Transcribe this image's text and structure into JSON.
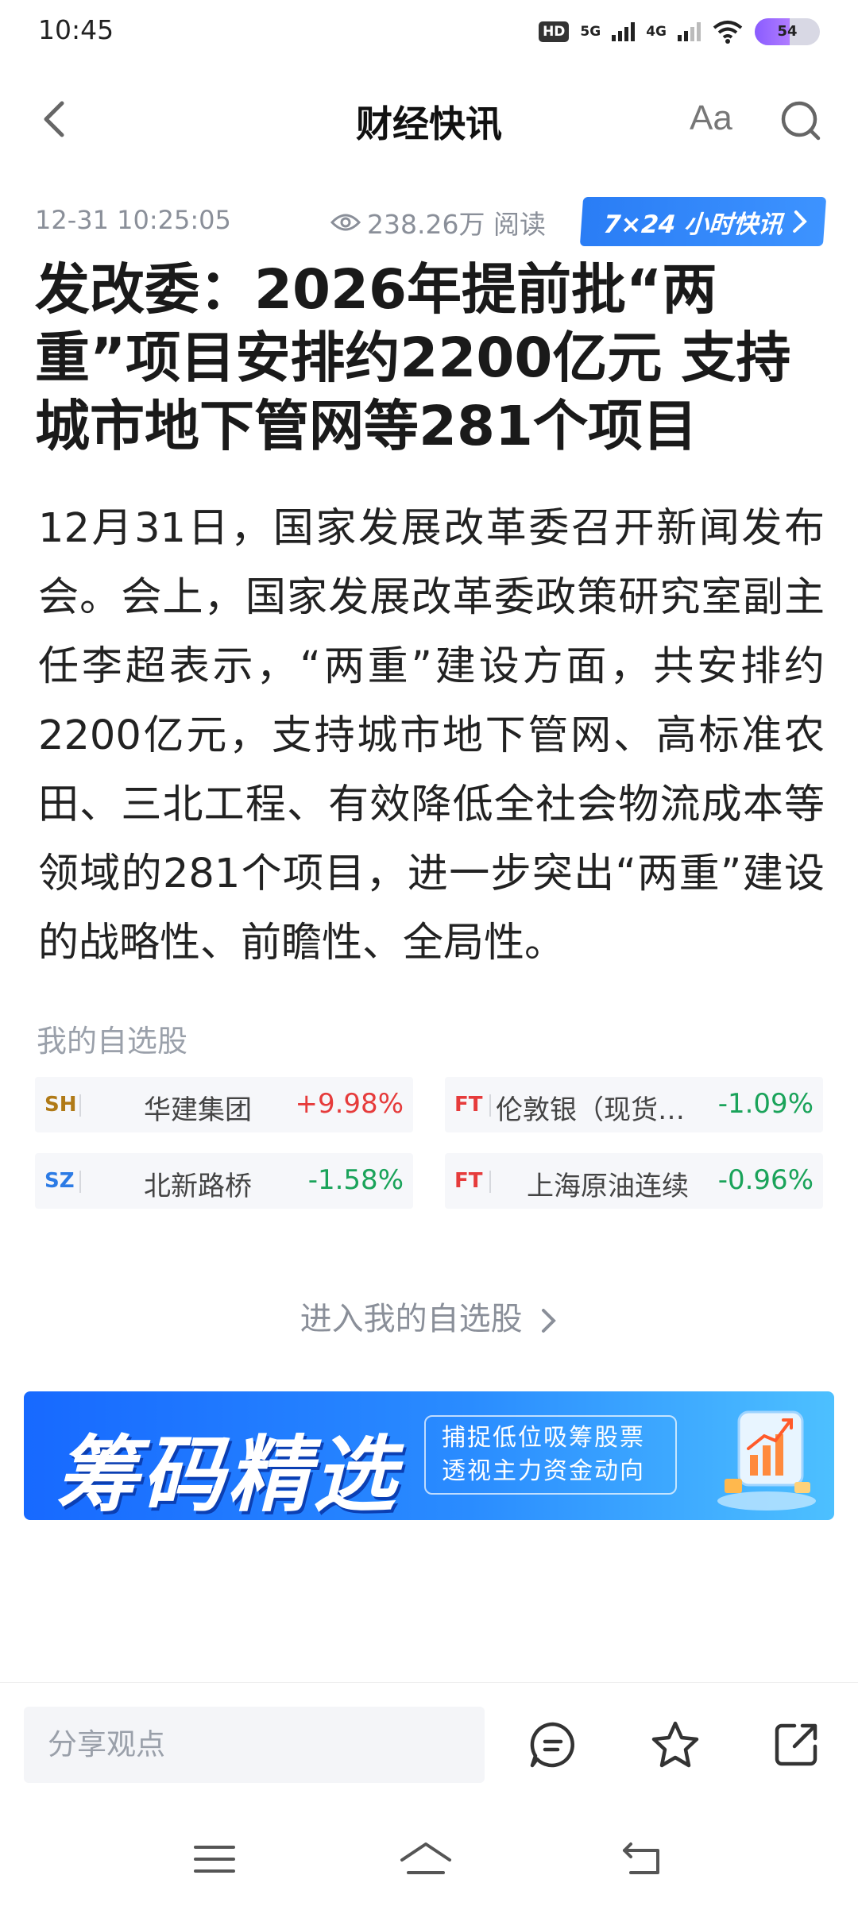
{
  "status_bar": {
    "time": "10:45",
    "hd_label": "HD",
    "net1": "5G",
    "net2": "4G",
    "battery": "54"
  },
  "nav": {
    "title": "财经快讯",
    "font_button": "Aa"
  },
  "meta": {
    "datetime": "12-31 10:25:05",
    "views": "238.26万 阅读",
    "badge": "7×24 小时快讯"
  },
  "headline": "发改委：2026年提前批“两重”项目安排约2200亿元 支持城市地下管网等281个项目",
  "article": "12月31日，国家发展改革委召开新闻发布会。会上，国家发展改革委政策研究室副主任李超表示，“两重”建设方面，共安排约2200亿元，支持城市地下管网、高标准农田、三北工程、有效降低全社会物流成本等领域的281个项目，进一步突出“两重”建设的战略性、前瞻性、全局性。",
  "watchlist": {
    "title": "我的自选股",
    "stocks": [
      {
        "market": "SH",
        "name": "华建集团",
        "change": "+9.98%"
      },
      {
        "market": "FT",
        "name": "伦敦银（现货白…",
        "change": "-1.09%"
      },
      {
        "market": "SZ",
        "name": "北新路桥",
        "change": "-1.58%"
      },
      {
        "market": "FT",
        "name": "上海原油连续",
        "change": "-0.96%"
      }
    ],
    "enter_label": "进入我的自选股"
  },
  "banner": {
    "main_text": "筹码精选",
    "sub_line1": "捕捉低位吸筹股票",
    "sub_line2": "透视主力资金动向"
  },
  "bottom_bar": {
    "share_placeholder": "分享观点"
  },
  "colors": {
    "accent_blue": "#2a7df5",
    "up_red": "#e63b3b",
    "down_green": "#1aa35a"
  }
}
